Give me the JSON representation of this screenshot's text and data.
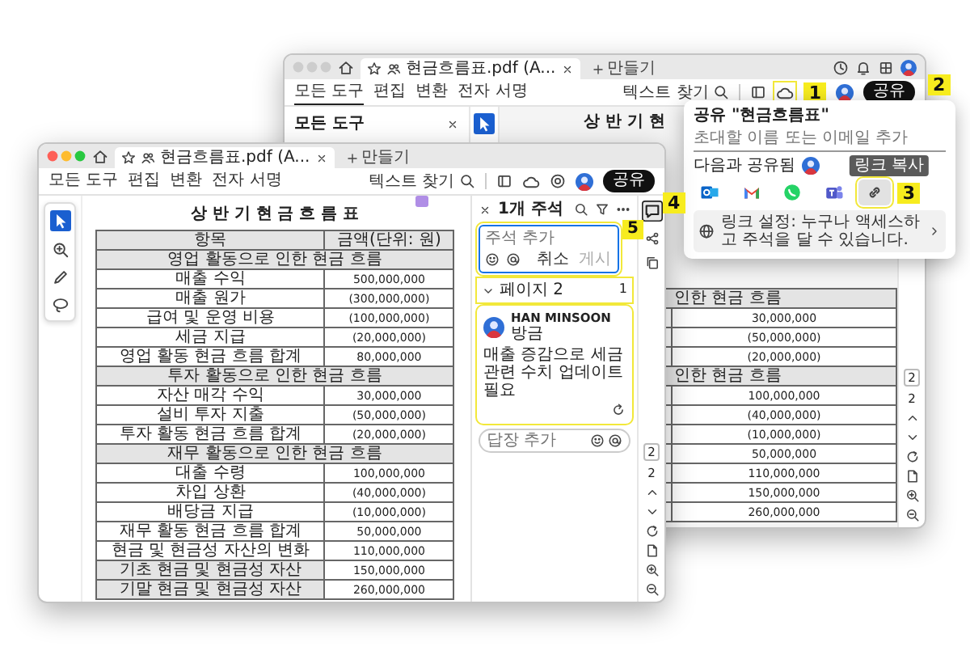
{
  "back_window": {
    "active": false,
    "tab_title": "현금흐름표.pdf (A...",
    "new_tab": "만들기",
    "menu": [
      {
        "label": "모든 도구",
        "selected": true
      },
      {
        "label": "편집",
        "selected": false
      },
      {
        "label": "변환",
        "selected": false
      },
      {
        "label": "전자 서명",
        "selected": false
      }
    ],
    "find": "텍스트 찾기",
    "share_button": "공유",
    "cloud_highlighted": true,
    "tools_panel_title": "모든 도구",
    "doc_title": "상 반 기 현",
    "table_rows": [
      {
        "kind": "section",
        "text": "인한 현금 흐름"
      },
      {
        "kind": "item",
        "amount": "30,000,000"
      },
      {
        "kind": "item",
        "amount": "(50,000,000)"
      },
      {
        "kind": "item",
        "amount": "(20,000,000)"
      },
      {
        "kind": "section",
        "text": "인한 현금 흐름"
      },
      {
        "kind": "item",
        "amount": "100,000,000"
      },
      {
        "kind": "item",
        "amount": "(40,000,000)"
      },
      {
        "kind": "item",
        "amount": "(10,000,000)"
      },
      {
        "kind": "item",
        "amount": "50,000,000"
      },
      {
        "kind": "item",
        "amount": "110,000,000"
      },
      {
        "kind": "item",
        "amount": "150,000,000"
      },
      {
        "kind": "item",
        "amount": "260,000,000"
      }
    ],
    "page_current": "2",
    "page_total": "2"
  },
  "share_popup": {
    "title": "공유 \"현금흐름표\"",
    "invite_placeholder": "초대할 이름 또는 이메일 추가",
    "shared_with": "다음과 공유됨",
    "targets": [
      {
        "kind": "outlook",
        "selected": false
      },
      {
        "kind": "gmail",
        "selected": false
      },
      {
        "kind": "whatsapp",
        "selected": false
      },
      {
        "kind": "teams",
        "selected": false
      },
      {
        "kind": "link",
        "selected": true,
        "highlighted": true
      }
    ],
    "tooltip": "링크 복사",
    "link_settings": "링크 설정: 누구나 액세스하고 주석을 달 수 있습니다."
  },
  "front_window": {
    "active": true,
    "tab_title": "현금흐름표.pdf (A...",
    "new_tab": "만들기",
    "menu": [
      {
        "label": "모든 도구",
        "selected": false
      },
      {
        "label": "편집",
        "selected": false
      },
      {
        "label": "변환",
        "selected": false
      },
      {
        "label": "전자 서명",
        "selected": false
      }
    ],
    "find": "텍스트 찾기",
    "share_button": "공유",
    "doc_title": "상 반 기 현 금 흐 름 표",
    "table": {
      "columns": [
        "항목",
        "금액(단위: 원)"
      ],
      "rows": [
        {
          "kind": "section",
          "text": "영업 활동으로 인한 현금 흐름"
        },
        {
          "kind": "item",
          "label": "매출 수익",
          "amount": "500,000,000"
        },
        {
          "kind": "item",
          "label": "매출 원가",
          "amount": "(300,000,000)"
        },
        {
          "kind": "item",
          "label": "급여 및 운영 비용",
          "amount": "(100,000,000)"
        },
        {
          "kind": "item",
          "label": "세금 지급",
          "amount": "(20,000,000)"
        },
        {
          "kind": "item",
          "label": "영업 활동 현금 흐름 합계",
          "amount": "80,000,000"
        },
        {
          "kind": "section",
          "text": "투자 활동으로 인한 현금 흐름"
        },
        {
          "kind": "item",
          "label": "자산 매각 수익",
          "amount": "30,000,000"
        },
        {
          "kind": "item",
          "label": "설비 투자 지출",
          "amount": "(50,000,000)"
        },
        {
          "kind": "item",
          "label": "투자 활동 현금 흐름 합계",
          "amount": "(20,000,000)"
        },
        {
          "kind": "section",
          "text": "재무 활동으로 인한 현금 흐름"
        },
        {
          "kind": "item",
          "label": "대출 수령",
          "amount": "100,000,000"
        },
        {
          "kind": "item",
          "label": "차입 상환",
          "amount": "(40,000,000)"
        },
        {
          "kind": "item",
          "label": "배당금 지급",
          "amount": "(10,000,000)"
        },
        {
          "kind": "item",
          "label": "재무 활동 현금 흐름 합계",
          "amount": "50,000,000"
        },
        {
          "kind": "item",
          "label": "현금 및 현금성 자산의 변화",
          "amount": "110,000,000"
        },
        {
          "kind": "total",
          "label": "기초 현금 및 현금성 자산",
          "amount": "150,000,000"
        },
        {
          "kind": "total",
          "label": "기말 현금 및 현금성 자산",
          "amount": "260,000,000"
        }
      ]
    },
    "page_current": "2",
    "page_total": "2"
  },
  "comments_panel": {
    "title": "1개 주석",
    "composer": {
      "placeholder": "주석 추가",
      "cancel": "취소",
      "post": "게시",
      "post_disabled": true,
      "highlighted": true
    },
    "page_group": {
      "label": "페이지 2",
      "count": "1",
      "expanded": true,
      "highlighted": true
    },
    "comments": [
      {
        "author": "HAN MINSOON",
        "time": "방금",
        "text": "매출 증감으로 세금 관련 수치 업데이트 필요",
        "highlighted": true
      }
    ],
    "reply_placeholder": "답장 추가"
  },
  "comment_tool_selected": true,
  "callouts": [
    "1",
    "2",
    "3",
    "4",
    "5"
  ]
}
